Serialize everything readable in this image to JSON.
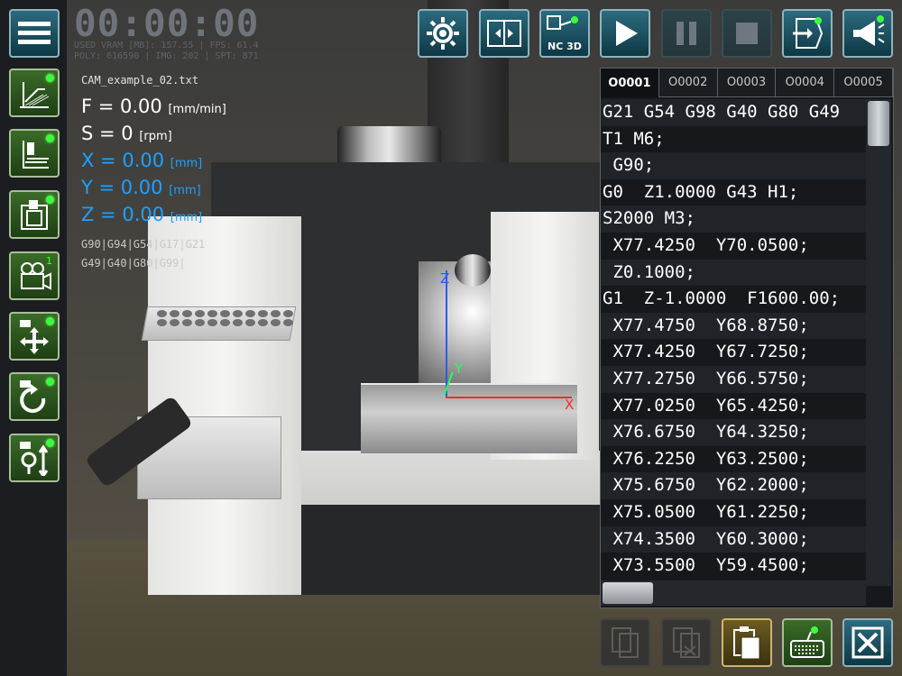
{
  "timer": "00:00:00",
  "stats": {
    "line1": "USED VRAM [MB]: 157.55 | FPS: 61.4",
    "line2": "POLY: 616590 | IMG: 202 | SPT: 871"
  },
  "file_name": "CAM_example_02.txt",
  "readouts": {
    "f_label": "F = 0.00",
    "f_unit": "[mm/min]",
    "s_label": "S = 0",
    "s_unit": "[rpm]",
    "x_label": "X = 0.00",
    "x_unit": "[mm]",
    "y_label": "Y = 0.00",
    "y_unit": "[mm]",
    "z_label": "Z = 0.00",
    "z_unit": "[mm]"
  },
  "gcodes": {
    "row1": "G90|G94|G54|G17|G21",
    "row2": "G49|G40|G80|G99|"
  },
  "axes": {
    "x": "X",
    "y": "Y",
    "z": "Z"
  },
  "top_buttons": {
    "settings_icon": "gear-icon",
    "nc3d_label": "NC 3D"
  },
  "camera_badge": "1",
  "tabs": [
    "O0001",
    "O0002",
    "O0003",
    "O0004",
    "O0005"
  ],
  "code_lines": [
    "G21 G54 G98 G40 G80 G49",
    "T1 M6;",
    " G90;",
    "G0  Z1.0000 G43 H1;",
    "S2000 M3;",
    " X77.4250  Y70.0500;",
    " Z0.1000;",
    "G1  Z-1.0000  F1600.00;",
    " X77.4750  Y68.8750;",
    " X77.4250  Y67.7250;",
    " X77.2750  Y66.5750;",
    " X77.0250  Y65.4250;",
    " X76.6750  Y64.3250;",
    " X76.2250  Y63.2500;",
    " X75.6750  Y62.2000;",
    " X75.0500  Y61.2250;",
    " X74.3500  Y60.3000;",
    " X73.5500  Y59.4500;"
  ],
  "colors": {
    "accent": "#1ea0ff",
    "led": "#3cff3c",
    "x_axis": "#ff2a2a",
    "y_axis": "#2aff5a",
    "z_axis": "#2a5aff"
  }
}
